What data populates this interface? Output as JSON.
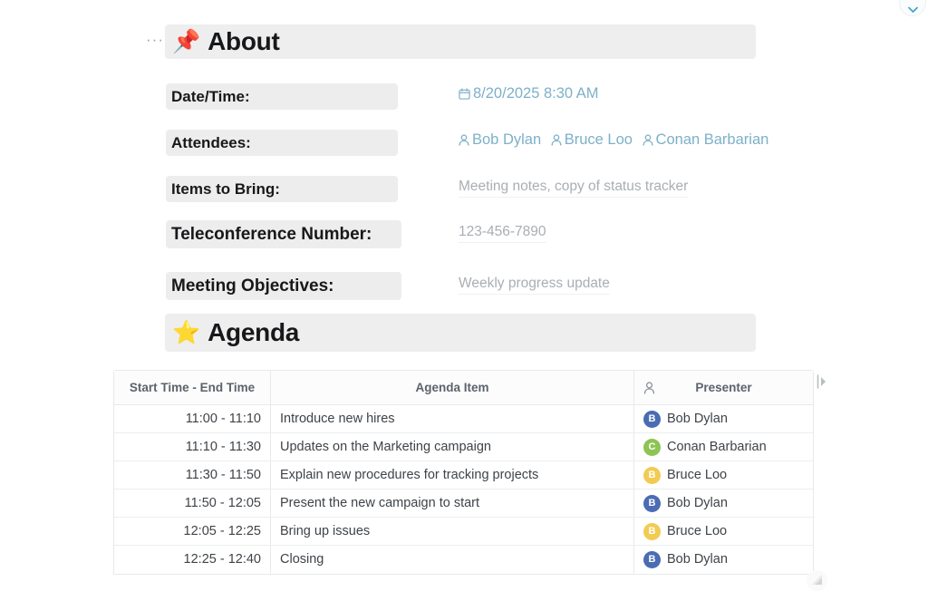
{
  "window": {
    "topright_button_icon": "chevron-down-icon"
  },
  "about": {
    "menu_handle": "···",
    "emoji": "📌",
    "emoji_name": "pushpin-emoji",
    "title": "About",
    "fields": [
      {
        "label": "Date/Time:",
        "value": "8/20/2025 8:30 AM",
        "style": "link-date"
      },
      {
        "label": "Attendees:",
        "value": "Bob Dylan Bruce Loo Conan Barbarian",
        "style": "link-people"
      },
      {
        "label": "Items to Bring:",
        "value": "Meeting notes, copy of status tracker",
        "style": "plain"
      },
      {
        "label": "Teleconference Number:",
        "value": "123-456-7890",
        "style": "plain"
      },
      {
        "label": "Meeting Objectives:",
        "value": "Weekly progress update",
        "style": "plain"
      }
    ],
    "attendees": [
      "Bob Dylan",
      "Bruce Loo",
      "Conan Barbarian"
    ],
    "datetime": "8/20/2025 8:30 AM"
  },
  "agenda": {
    "emoji": "⭐",
    "emoji_name": "star-emoji",
    "title": "Agenda",
    "columns": [
      "Start Time - End Time",
      "Agenda Item",
      "Presenter"
    ],
    "presenter_column_icon": "person-icon",
    "rows": [
      {
        "time": "11:00 - 11:10",
        "item": "Introduce new hires",
        "presenter": "Bob Dylan",
        "initial": "B",
        "color": "#4a6cb3"
      },
      {
        "time": "11:10 - 11:30",
        "item": "Updates on the Marketing campaign",
        "presenter": "Conan Barbarian",
        "initial": "C",
        "color": "#8dc454"
      },
      {
        "time": "11:30 - 11:50",
        "item": "Explain new procedures for tracking projects",
        "presenter": "Bruce Loo",
        "initial": "B",
        "color": "#f3cb52"
      },
      {
        "time": "11:50 - 12:05",
        "item": "Present the new campaign to start",
        "presenter": "Bob Dylan",
        "initial": "B",
        "color": "#4a6cb3"
      },
      {
        "time": "12:05 - 12:25",
        "item": "Bring up issues",
        "presenter": "Bruce Loo",
        "initial": "B",
        "color": "#f3cb52"
      },
      {
        "time": "12:25 - 12:40",
        "item": "Closing",
        "presenter": "Bob Dylan",
        "initial": "B",
        "color": "#4a6cb3"
      }
    ]
  },
  "controls": {
    "column_expand_icon": "expand-column-icon",
    "resize_grip_icon": "resize-handle-icon"
  },
  "colors": {
    "band_bg": "#eeeeee",
    "label_bg": "#ededed",
    "link_blue": "#7db0c8",
    "value_gray": "#a9aeb3",
    "item_col_bg": "#f2f2f2"
  }
}
